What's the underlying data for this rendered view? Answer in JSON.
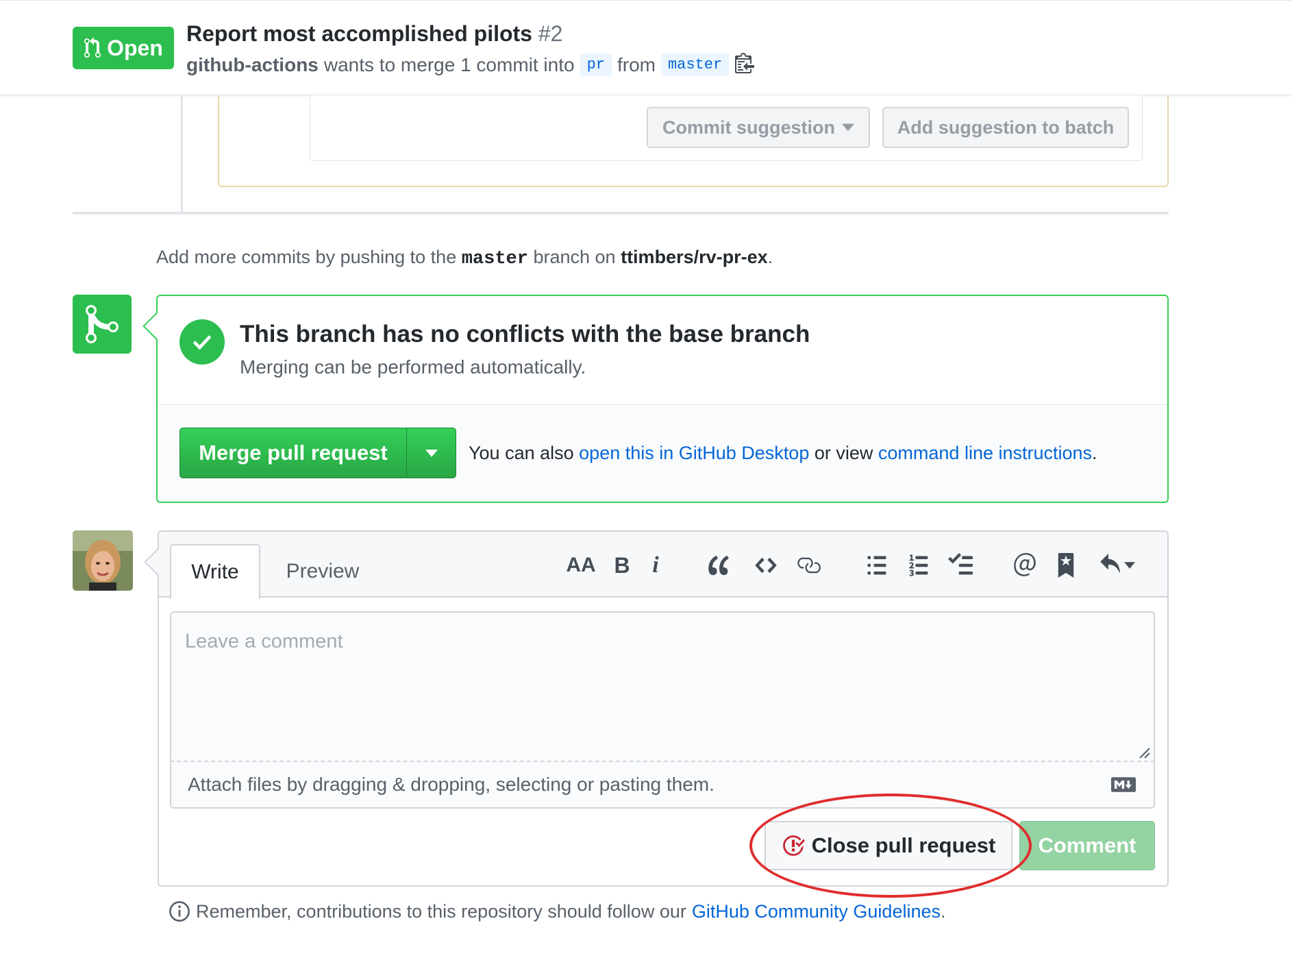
{
  "header": {
    "state": "Open",
    "title": "Report most accomplished pilots",
    "number": "#2",
    "author": "github-actions",
    "merge_text": "wants to merge 1 commit into",
    "base_branch": "pr",
    "from_text": "from",
    "head_branch": "master"
  },
  "suggestion": {
    "commit_label": "Commit suggestion",
    "batch_label": "Add suggestion to batch"
  },
  "push_note": {
    "prefix": "Add more commits by pushing to the",
    "branch": "master",
    "middle": "branch on",
    "repo": "ttimbers/rv-pr-ex",
    "suffix": "."
  },
  "merge": {
    "heading": "This branch has no conflicts with the base branch",
    "subheading": "Merging can be performed automatically.",
    "button_label": "Merge pull request",
    "also_text": "You can also",
    "desktop_link": "open this in GitHub Desktop",
    "or_view": "or view",
    "cli_link": "command line instructions",
    "period": "."
  },
  "comment": {
    "tabs": [
      "Write",
      "Preview"
    ],
    "heading_tool": "AA",
    "bold_tool": "B",
    "italic_tool": "i",
    "placeholder": "Leave a comment",
    "attach_text": "Attach files by dragging & dropping, selecting or pasting them.",
    "close_label": "Close pull request",
    "comment_label": "Comment"
  },
  "footer": {
    "text": "Remember, contributions to this repository should follow our",
    "link": "GitHub Community Guidelines",
    "period": "."
  },
  "colors": {
    "green": "#2cbe4e",
    "link": "#0366d6",
    "annotation": "#e02d2d"
  },
  "icons": [
    "git-pull-request-icon",
    "clipboard-icon",
    "git-merge-icon",
    "check-icon",
    "caret-down-icon",
    "text-size-icon",
    "bold-icon",
    "italic-icon",
    "quote-icon",
    "code-icon",
    "link-icon",
    "unordered-list-icon",
    "ordered-list-icon",
    "task-list-icon",
    "mention-icon",
    "saved-reply-icon",
    "reply-icon",
    "markdown-icon",
    "issue-closed-icon",
    "info-icon"
  ]
}
